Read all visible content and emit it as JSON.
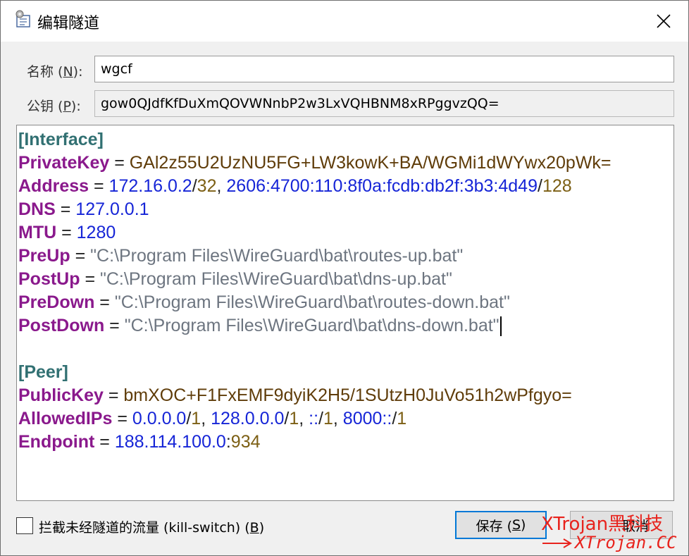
{
  "window": {
    "title": "编辑隧道",
    "close_glyph": "✕"
  },
  "name": {
    "label_prefix": "名称 (",
    "label_key": "N",
    "label_suffix": "):",
    "value": "wgcf"
  },
  "public_key": {
    "label_prefix": "公钥 (",
    "label_key": "P",
    "label_suffix": "):",
    "value": "gow0QJdfKfDuXmQOVWNnbP2w3LxVQHBNM8xRPggvzQQ="
  },
  "config": {
    "interface_header": "[Interface]",
    "private_key": {
      "key": "PrivateKey",
      "eq": " = ",
      "value": "GAl2z55U2UzNU5FG+LW3kowK+BA/WGMi1dWYwx20pWk="
    },
    "address": {
      "key": "Address",
      "eq": " = ",
      "ip1": "172.16.0.2",
      "slash1": "/",
      "cidr1": "32",
      "sep": ", ",
      "ip2": "2606:4700:110:8f0a:fcdb:db2f:3b3:4d49",
      "slash2": "/",
      "cidr2": "128"
    },
    "dns": {
      "key": "DNS",
      "eq": " = ",
      "value": "127.0.0.1"
    },
    "mtu": {
      "key": "MTU",
      "eq": " = ",
      "value": "1280"
    },
    "preup": {
      "key": "PreUp",
      "eq": " = ",
      "value": "\"C:\\Program Files\\WireGuard\\bat\\routes-up.bat\""
    },
    "postup": {
      "key": "PostUp",
      "eq": " = ",
      "value": "\"C:\\Program Files\\WireGuard\\bat\\dns-up.bat\""
    },
    "predown": {
      "key": "PreDown",
      "eq": " = ",
      "value": "\"C:\\Program Files\\WireGuard\\bat\\routes-down.bat\""
    },
    "postdown": {
      "key": "PostDown",
      "eq": " = ",
      "value": "\"C:\\Program Files\\WireGuard\\bat\\dns-down.bat\""
    },
    "peer_header": "[Peer]",
    "public_key": {
      "key": "PublicKey",
      "eq": " = ",
      "value": "bmXOC+F1FxEMF9dyiK2H5/1SUtzH0JuVo51h2wPfgyo="
    },
    "allowed_ips": {
      "key": "AllowedIPs",
      "eq": " = ",
      "ip1": "0.0.0.0",
      "c1": "1",
      "ip2": "128.0.0.0",
      "c2": "1",
      "ip3": "::",
      "c3": "1",
      "ip4": "8000::",
      "c4": "1",
      "slash": "/",
      "sep": ", "
    },
    "endpoint": {
      "key": "Endpoint",
      "eq": " = ",
      "host": "188.114.100.0",
      "colon": ":",
      "port": "934"
    }
  },
  "kill_switch": {
    "label_prefix": "拦截未经隧道的流量 (kill-switch) (",
    "label_key": "B",
    "label_suffix": ")",
    "checked": false
  },
  "buttons": {
    "save_prefix": "保存 (",
    "save_key": "S",
    "save_suffix": ")",
    "cancel_label": "取消"
  },
  "watermark": {
    "line1": "XTrojan黑科技",
    "line2": "XTrojan.CC"
  },
  "colors": {
    "section": "#317072",
    "key": "#8a198c",
    "ip": "#1625d7",
    "cidr": "#7c5f14",
    "string": "#6d7580",
    "watermark": "#e8231d",
    "focus": "#0078d7"
  }
}
